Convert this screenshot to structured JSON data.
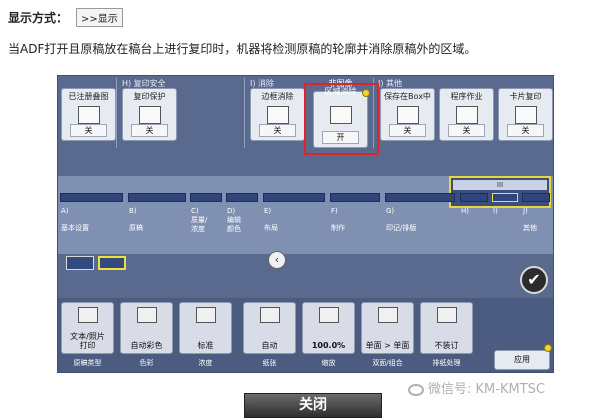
{
  "display_mode": {
    "label": "显示方式：",
    "button": ">>显示"
  },
  "description": "当ADF打开且原稿放在稿台上进行复印时，机器将检测原稿的轮廓并消除原稿外的区域。",
  "panel": {
    "section_headers": {
      "h": "H)  复印安全",
      "i": "I)  消除",
      "j": "J)  其他"
    },
    "function_buttons": [
      {
        "title": "已注册叠图",
        "value": "关",
        "icon": "overlay-icon"
      },
      {
        "title": "复印保护",
        "value": "关",
        "icon": "protect-icon"
      },
      {
        "title": "边框消除",
        "value": "关",
        "icon": "frame-erase-icon"
      },
      {
        "title": "非图像\n区域消除",
        "value": "开",
        "icon": "non-image-erase-icon",
        "highlighted": true
      },
      {
        "title": "保存在Box中",
        "value": "关",
        "icon": "box-save-icon"
      },
      {
        "title": "程序作业",
        "value": "关",
        "icon": "program-job-icon"
      },
      {
        "title": "卡片复印",
        "value": "关",
        "icon": "card-copy-icon"
      }
    ],
    "scroll_label": "III",
    "tabs": [
      {
        "letter": "A)",
        "name": "基本设置"
      },
      {
        "letter": "B)",
        "name": "原稿"
      },
      {
        "letter": "C)",
        "name": "质量/\n浓度"
      },
      {
        "letter": "D)",
        "name": "编辑\n颜色"
      },
      {
        "letter": "E)",
        "name": "布局"
      },
      {
        "letter": "F)",
        "name": "制作"
      },
      {
        "letter": "G)",
        "name": "印记/排版"
      },
      {
        "letter": "H)",
        "name": ""
      },
      {
        "letter": "I)",
        "name": ""
      },
      {
        "letter": "J)",
        "name": "其他"
      }
    ],
    "bottom_buttons": [
      {
        "value": "文本/照片\n打印",
        "name": "原稿类型",
        "icon": "doc-type-icon"
      },
      {
        "value": "自动彩色",
        "name": "色彩",
        "icon": "color-icon"
      },
      {
        "value": "标准",
        "name": "浓度",
        "icon": "density-icon"
      },
      {
        "value": "自动",
        "name": "纸张",
        "icon": "paper-icon"
      },
      {
        "value": "100.0%",
        "name": "缩放",
        "icon": "zoom-icon"
      },
      {
        "value": "单面 > 单面",
        "name": "双面/组合",
        "icon": "duplex-icon"
      },
      {
        "value": "不装订",
        "name": "排纸处理",
        "icon": "finishing-icon"
      }
    ],
    "apply_label": "应用"
  },
  "watermark": "微信号: KM-KMTSC",
  "close_button": "关闭",
  "colors": {
    "panel_bg": "#5a6a8e",
    "highlight_box": "#e0222a",
    "selected_border": "#f1dd3b"
  }
}
